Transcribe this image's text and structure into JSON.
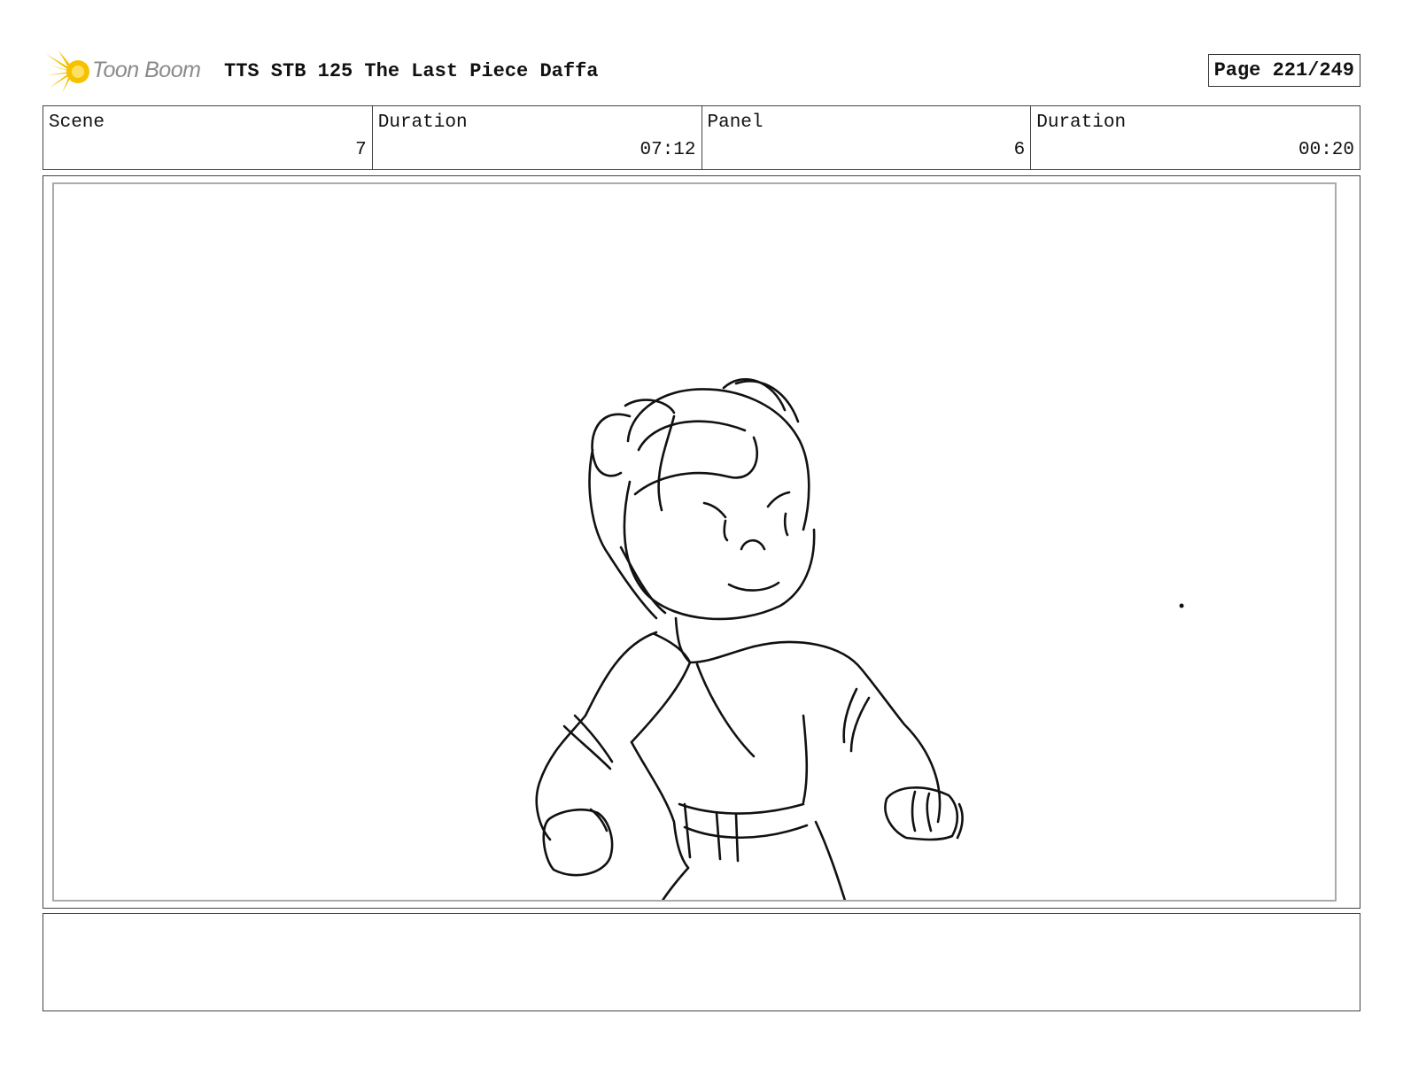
{
  "header": {
    "logo_text": "Toon Boom",
    "title": "TTS STB 125 The Last Piece Daffa",
    "page": "Page 221/249"
  },
  "info": {
    "scene_label": "Scene",
    "scene_value": "7",
    "duration_label": "Duration",
    "duration_value": "07:12",
    "panel_label": "Panel",
    "panel_value": "6",
    "panel_duration_label": "Duration",
    "panel_duration_value": "00:20"
  },
  "panel": {
    "image": "sketch-girl-with-neckerchief-clenched-fists"
  },
  "notes": {
    "text": ""
  },
  "colors": {
    "logo_accent": "#f5c200",
    "logo_text": "#8a8a8a",
    "border": "#444444",
    "frame_inner": "#aaaaaa"
  }
}
